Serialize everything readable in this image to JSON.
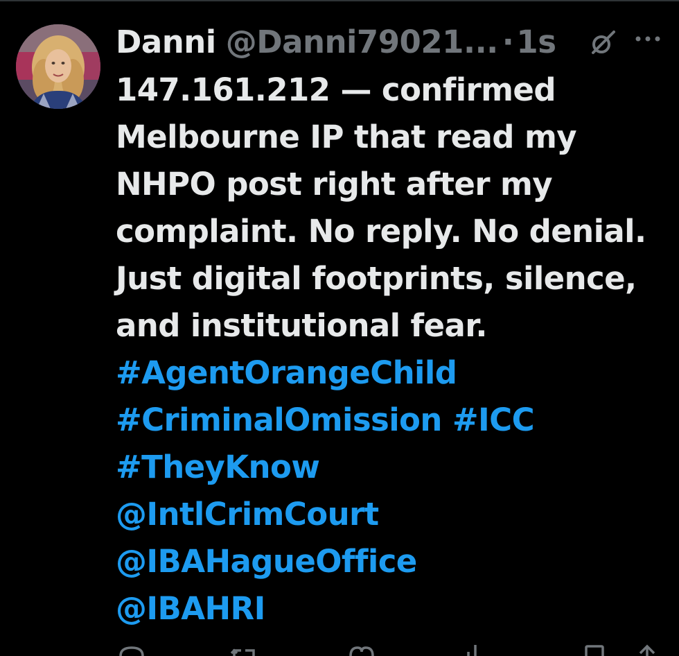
{
  "post": {
    "display_name": "Danni",
    "handle": "@Danni79021...",
    "separator": "·",
    "time": "1s",
    "text_lines": [
      "147.161.212 — confirmed",
      "Melbourne IP that read my",
      "NHPO post right after my",
      "complaint. No reply. No denial.",
      "Just digital footprints, silence,",
      "and institutional fear."
    ],
    "hashtag_line_1": "#AgentOrangeChild",
    "hashtag_line_2a": "#CriminalOmission",
    "hashtag_line_2b": "#ICC",
    "hashtag_line_3": "#TheyKnow",
    "mentions": [
      "@IntlCrimCourt",
      "@IBAHagueOffice",
      "@IBAHRI"
    ]
  },
  "icons": {
    "avatar": "profile-photo",
    "grok": "grok-icon",
    "more": "more-options-icon",
    "actions": [
      "reply-icon",
      "repost-icon",
      "like-icon",
      "views-icon",
      "bookmark-icon",
      "share-icon"
    ]
  },
  "colors": {
    "background": "#000000",
    "text": "#e7e9ea",
    "secondary": "#71767b",
    "link": "#1d9bf0"
  }
}
